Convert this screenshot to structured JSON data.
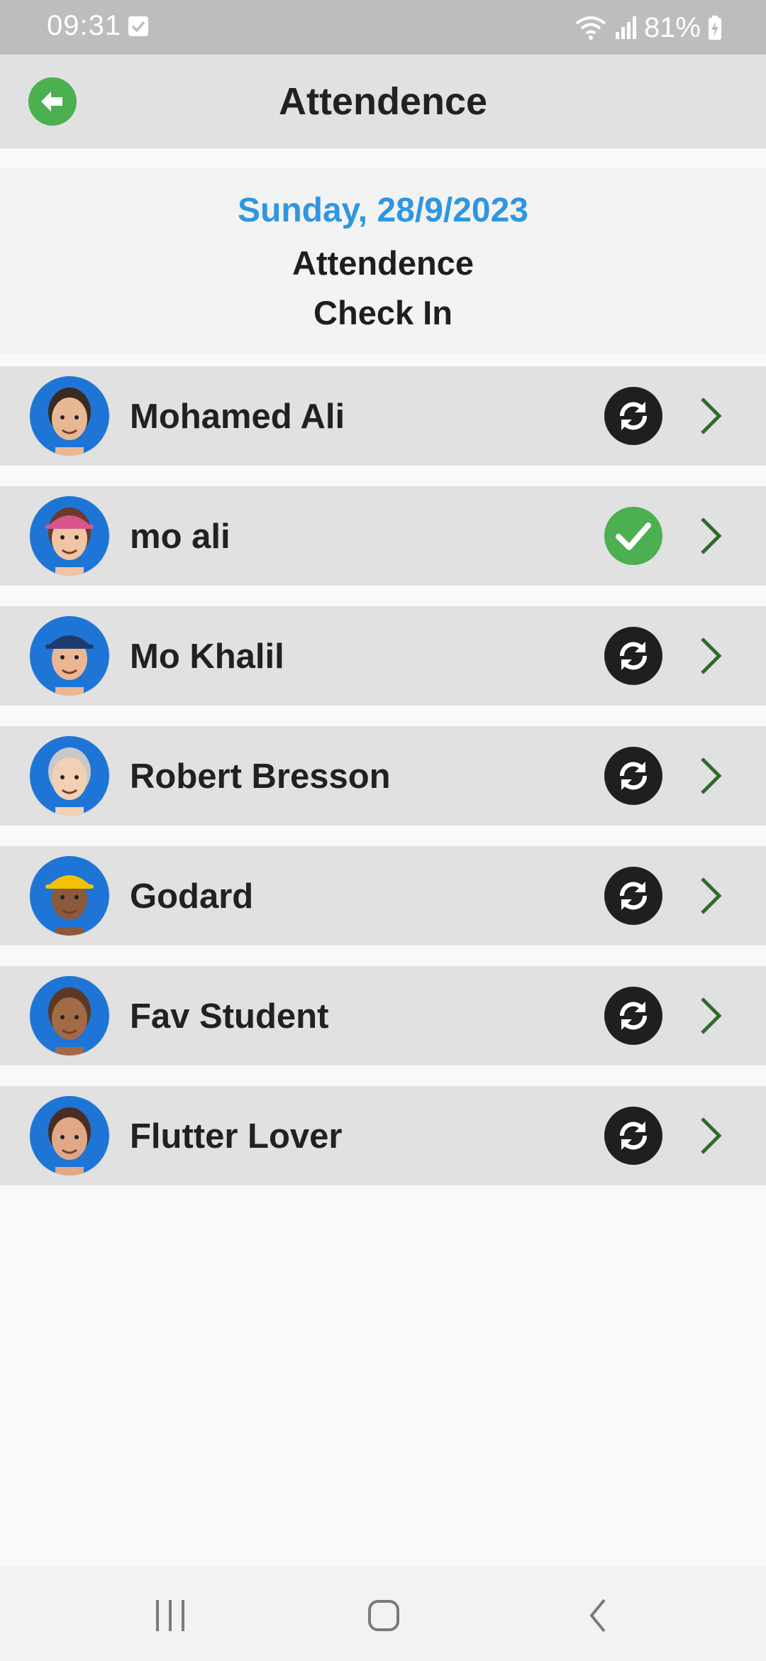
{
  "status_bar": {
    "time": "09:31",
    "battery": "81%",
    "icons": [
      "checkbox-notification-icon",
      "wifi-icon",
      "signal-icon",
      "battery-charging-icon"
    ]
  },
  "app_bar": {
    "title": "Attendence",
    "back_icon": "arrow-left-circle-icon",
    "accent_color": "#4caf50"
  },
  "header": {
    "date": "Sunday, 28/9/2023",
    "subtitle": "Attendence",
    "mode": "Check In",
    "date_color": "#2f96e0"
  },
  "students": [
    {
      "name": "Mohamed Ali",
      "status": "pending",
      "status_icon": "sync-icon"
    },
    {
      "name": "mo ali",
      "status": "present",
      "status_icon": "check-icon"
    },
    {
      "name": "Mo Khalil",
      "status": "pending",
      "status_icon": "sync-icon"
    },
    {
      "name": "Robert Bresson",
      "status": "pending",
      "status_icon": "sync-icon"
    },
    {
      "name": "Godard",
      "status": "pending",
      "status_icon": "sync-icon"
    },
    {
      "name": "Fav Student",
      "status": "pending",
      "status_icon": "sync-icon"
    },
    {
      "name": "Flutter Lover",
      "status": "pending",
      "status_icon": "sync-icon"
    }
  ],
  "nav_bar": {
    "buttons": [
      "recent-apps-icon",
      "home-icon",
      "back-icon"
    ]
  }
}
